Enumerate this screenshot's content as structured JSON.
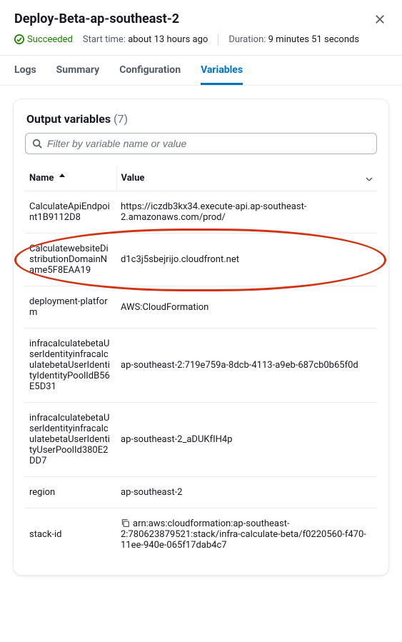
{
  "header": {
    "title": "Deploy-Beta-ap-southeast-2",
    "status": "Succeeded",
    "start_label": "Start time:",
    "start_value": "about 13 hours ago",
    "duration_label": "Duration:",
    "duration_value": "9 minutes 51 seconds"
  },
  "tabs": [
    {
      "label": "Logs",
      "active": false
    },
    {
      "label": "Summary",
      "active": false
    },
    {
      "label": "Configuration",
      "active": false
    },
    {
      "label": "Variables",
      "active": true
    }
  ],
  "card": {
    "title": "Output variables",
    "count": "(7)",
    "search_placeholder": "Filter by variable name or value",
    "columns": {
      "name": "Name",
      "value": "Value"
    }
  },
  "rows": [
    {
      "name": "CalculateApiEndpoint1B9112D8",
      "value": "https://iczdb3kx34.execute-api.ap-southeast-2.amazonaws.com/prod/",
      "copy": false,
      "highlight": false
    },
    {
      "name": "CalculatewebsiteDistributionDomainName5F8EAA19",
      "value": "d1c3j5sbejrijo.cloudfront.net",
      "copy": false,
      "highlight": true
    },
    {
      "name": "deployment-platform",
      "value": "AWS:CloudFormation",
      "copy": false,
      "highlight": false
    },
    {
      "name": "infracalculatebetaUserIdentityinfracalculatebetaUserIdentityIdentityPoolIdB56E5D31",
      "value": "ap-southeast-2:719e759a-8dcb-4113-a9eb-687cb0b65f0d",
      "copy": false,
      "highlight": false
    },
    {
      "name": "infracalculatebetaUserIdentityinfracalculatebetaUserIdentityUserPoolId380E2DD7",
      "value": "ap-southeast-2_aDUKfIH4p",
      "copy": false,
      "highlight": false
    },
    {
      "name": "region",
      "value": "ap-southeast-2",
      "copy": false,
      "highlight": false
    },
    {
      "name": "stack-id",
      "value": "arn:aws:cloudformation:ap-southeast-2:780623879521:stack/infra-calculate-beta/f0220560-f470-11ee-940e-065f17dab4c7",
      "copy": true,
      "highlight": false
    }
  ]
}
